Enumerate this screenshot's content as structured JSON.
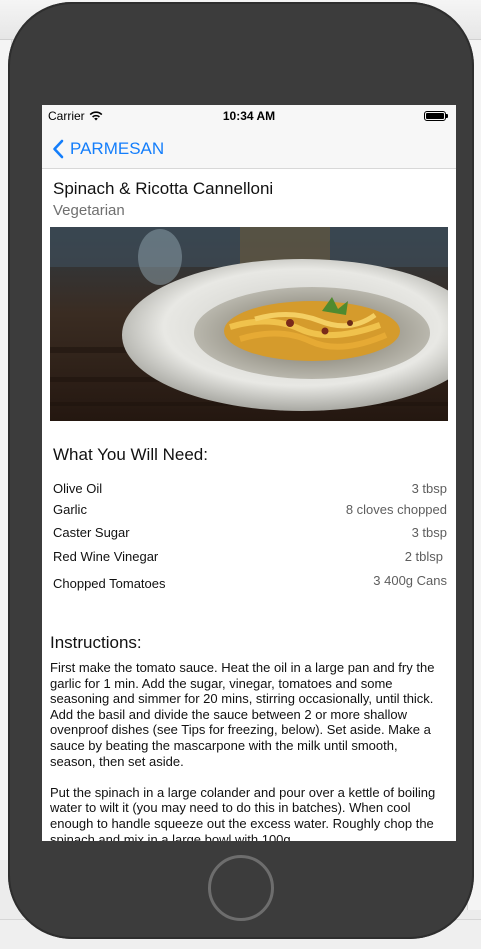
{
  "status_bar": {
    "carrier": "Carrier",
    "time": "10:34 AM",
    "icons": [
      "wifi-icon",
      "battery-icon"
    ]
  },
  "nav": {
    "back_label": "PARMESAN",
    "back_icon": "chevron-left-icon",
    "accent_color": "#147efb"
  },
  "recipe": {
    "title": "Spinach & Ricotta Cannelloni",
    "category": "Vegetarian"
  },
  "ingredients": {
    "heading": "What You Will Need:",
    "items": [
      {
        "name": "Olive Oil",
        "quantity": "3 tbsp"
      },
      {
        "name": "Garlic",
        "quantity": "8 cloves chopped"
      },
      {
        "name": "Caster Sugar",
        "quantity": "3 tbsp"
      },
      {
        "name": "Red Wine Vinegar",
        "quantity": "2 tblsp"
      },
      {
        "name": "Chopped Tomatoes",
        "quantity": "3 400g Cans"
      }
    ]
  },
  "instructions": {
    "heading": "Instructions:",
    "paragraphs": [
      "First make the tomato sauce. Heat the oil in a large pan and fry the garlic for 1 min. Add the sugar, vinegar, tomatoes and some seasoning and simmer for 20 mins, stirring occasionally, until thick. Add the basil and divide the sauce between 2 or more shallow ovenproof dishes (see Tips for freezing, below). Set aside. Make a sauce by beating the mascarpone with the milk until smooth, season, then set aside.",
      "Put the spinach in a large colander and pour over a kettle of boiling water to wilt it (you may need to do this in batches). When cool enough to handle squeeze out the excess water. Roughly chop the spinach and mix in a large bowl with 100g"
    ]
  }
}
